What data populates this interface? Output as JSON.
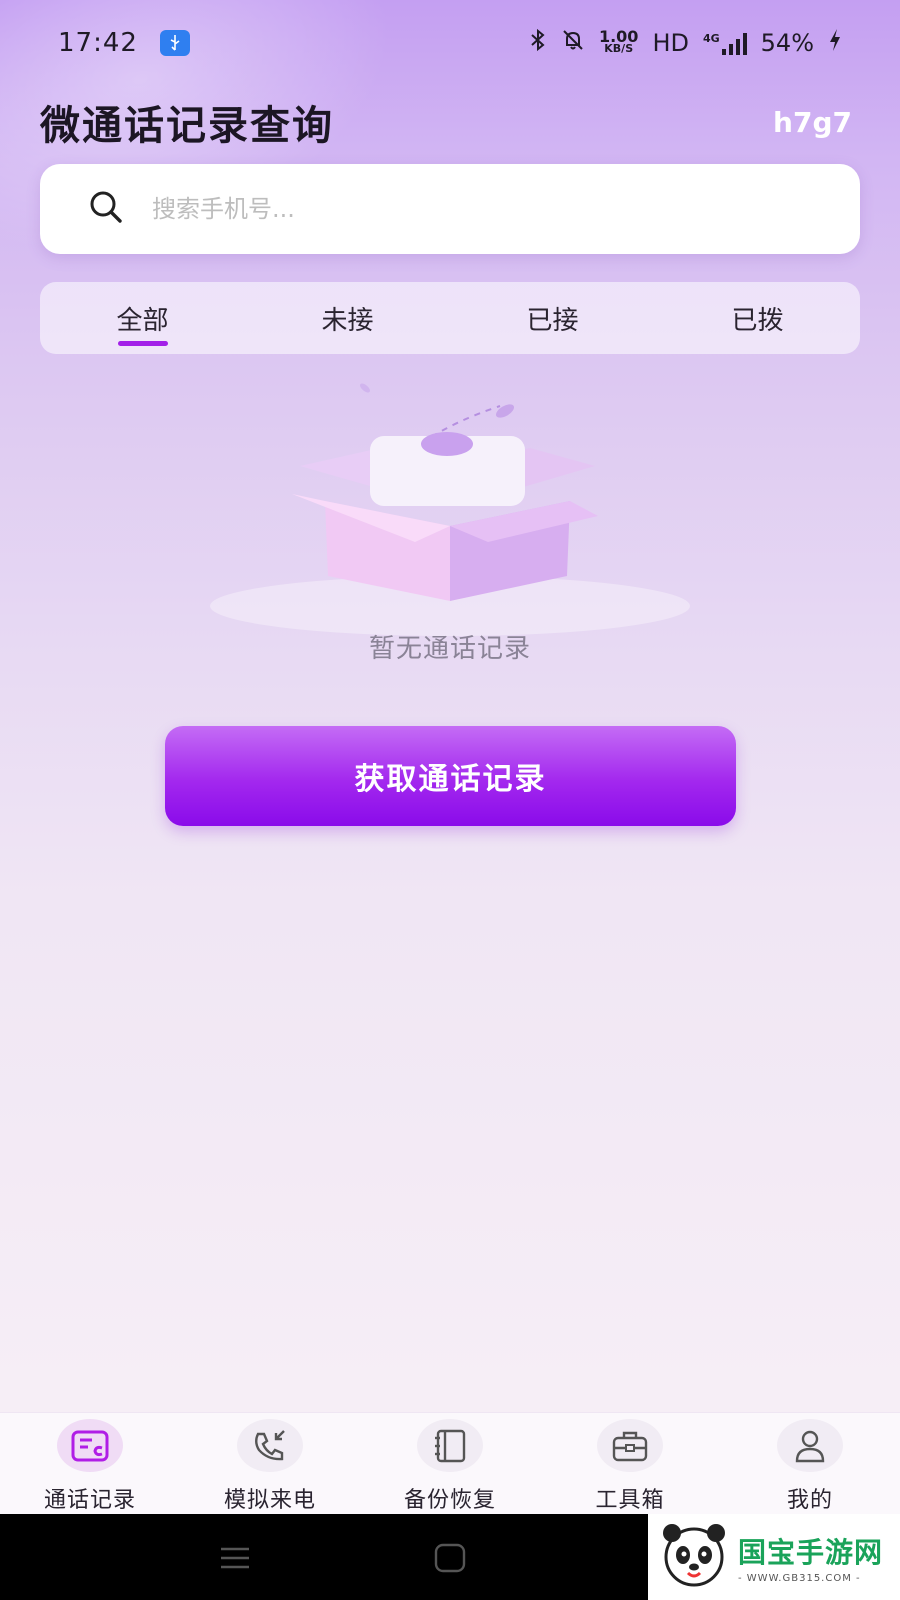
{
  "status_bar": {
    "time": "17:42",
    "net_speed_value": "1.00",
    "net_speed_unit": "KB/S",
    "hd": "HD",
    "network": "4G",
    "battery": "54%"
  },
  "header": {
    "title": "微通话记录查询",
    "user_code": "h7g7"
  },
  "search": {
    "placeholder": "搜索手机号..."
  },
  "tabs": [
    {
      "label": "全部",
      "active": true
    },
    {
      "label": "未接",
      "active": false
    },
    {
      "label": "已接",
      "active": false
    },
    {
      "label": "已拨",
      "active": false
    }
  ],
  "empty_state": {
    "message": "暂无通话记录"
  },
  "actions": {
    "fetch_label": "获取通话记录"
  },
  "bottom_nav": [
    {
      "label": "通话记录",
      "icon": "call-log-icon",
      "active": true
    },
    {
      "label": "模拟来电",
      "icon": "incoming-call-icon",
      "active": false
    },
    {
      "label": "备份恢复",
      "icon": "backup-icon",
      "active": false
    },
    {
      "label": "工具箱",
      "icon": "toolbox-icon",
      "active": false
    },
    {
      "label": "我的",
      "icon": "profile-icon",
      "active": false
    }
  ],
  "watermark": {
    "main": "国宝手游网",
    "sub": "- WWW.GB315.COM -"
  },
  "colors": {
    "accent": "#a320e8",
    "button_top": "#c46cf5",
    "button_bottom": "#8a0bea",
    "background_top": "#c49ff2",
    "background_bottom": "#f6eef6"
  }
}
